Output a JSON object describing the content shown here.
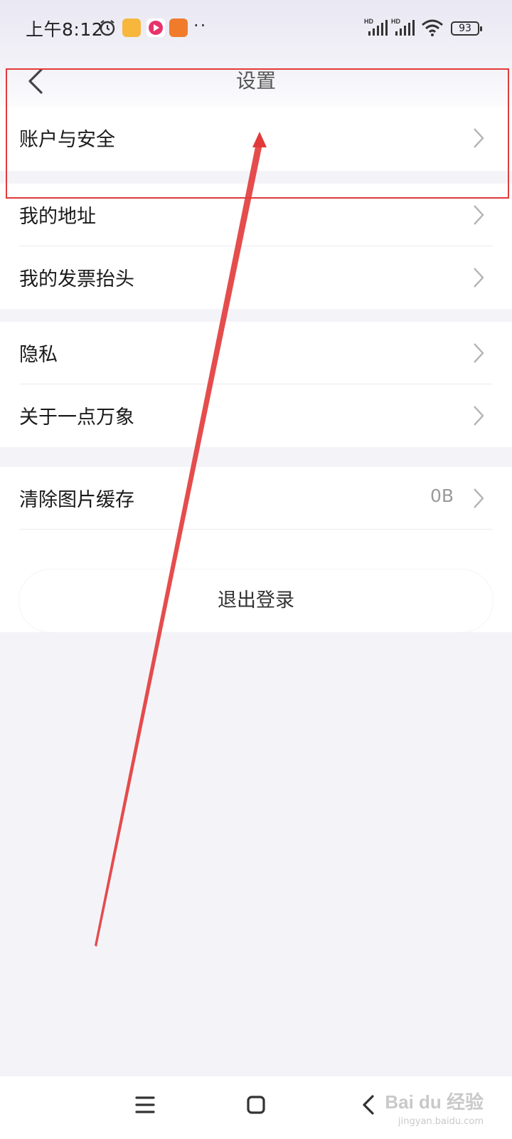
{
  "status_bar": {
    "time": "上午8:12",
    "more": "··",
    "battery": "93"
  },
  "header": {
    "title": "设置"
  },
  "groups": [
    {
      "items": [
        {
          "label": "账户与安全"
        }
      ]
    },
    {
      "items": [
        {
          "label": "我的地址"
        },
        {
          "label": "我的发票抬头"
        }
      ]
    },
    {
      "items": [
        {
          "label": "隐私"
        },
        {
          "label": "关于一点万象"
        }
      ]
    },
    {
      "items": [
        {
          "label": "清除图片缓存",
          "value": "0B"
        }
      ]
    }
  ],
  "logout": {
    "label": "退出登录"
  },
  "icons": {
    "back": "back-icon",
    "chevron": "chevron-right-icon",
    "alarm": "alarm-icon",
    "wifi": "wifi-icon",
    "signal": "signal-icon",
    "nav_menu": "menu-icon",
    "nav_home": "home-icon",
    "nav_back": "back-icon"
  },
  "watermark": {
    "brand": "Bai du 经验",
    "site": "jingyan.baidu.com"
  },
  "colors": {
    "annotation": "#e23a3a",
    "background": "#f4f4f8"
  }
}
